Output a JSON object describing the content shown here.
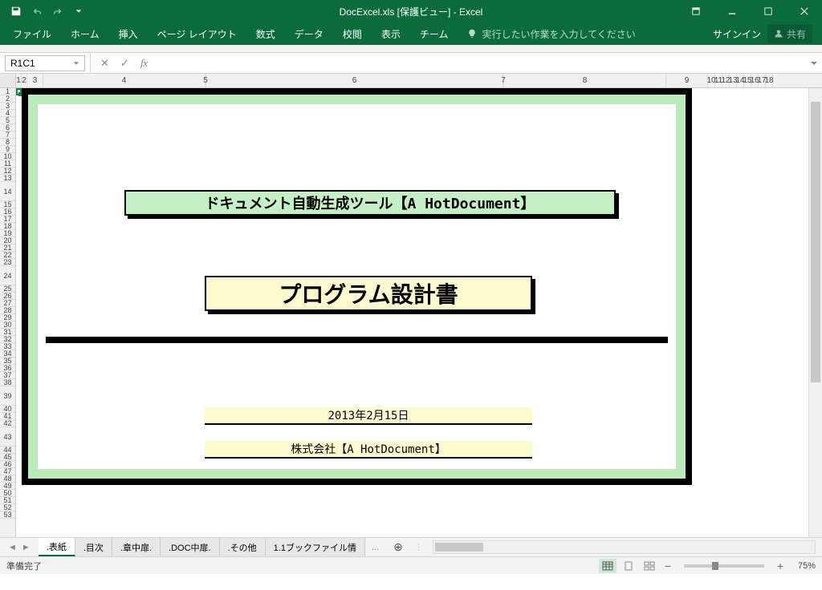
{
  "app": {
    "title": "DocExcel.xls [保護ビュー] - Excel",
    "signin": "サインイン",
    "share": "共有"
  },
  "ribbon": {
    "tabs": [
      "ファイル",
      "ホーム",
      "挿入",
      "ページ レイアウト",
      "数式",
      "データ",
      "校閲",
      "表示",
      "チーム"
    ],
    "tellme": "実行したい作業を入力してください"
  },
  "formula": {
    "namebox": "R1C1",
    "fx": "fx"
  },
  "columns": {
    "headers": [
      "1",
      "2",
      "3",
      "4",
      "5",
      "6",
      "7",
      "8",
      "9",
      "10",
      "11",
      "12",
      "13",
      "14",
      "15",
      "16",
      "17",
      "18"
    ],
    "widths": [
      7,
      7,
      20,
      202,
      1,
      370,
      1,
      202,
      52,
      9,
      9,
      9,
      9,
      9,
      9,
      9,
      9,
      9
    ]
  },
  "rows": [
    "1",
    "2",
    "3",
    "4",
    "5",
    "6",
    "7",
    "8",
    "9",
    "10",
    "11",
    "12",
    "13",
    "14",
    "15",
    "16",
    "17",
    "18",
    "19",
    "20",
    "21",
    "22",
    "23",
    "24",
    "25",
    "26",
    "27",
    "28",
    "29",
    "30",
    "31",
    "32",
    "33",
    "34",
    "35",
    "36",
    "37",
    "38",
    "39",
    "40",
    "41",
    "42",
    "43",
    "44",
    "45",
    "46",
    "47",
    "48",
    "49",
    "50",
    "51",
    "52",
    "53"
  ],
  "row_heights": {
    "default": 9,
    "14": 24,
    "24": 24,
    "39": 24,
    "43": 24
  },
  "cover": {
    "banner1": "ドキュメント自動生成ツール【A HotDocument】",
    "banner2": "プログラム設計書",
    "date": "2013年2月15日",
    "company": "株式会社【A HotDocument】"
  },
  "sheets": {
    "active": 0,
    "tabs": [
      ".表紙",
      ".目次",
      ".章中扉.",
      ".DOC中扉.",
      ".その他",
      "1.1ブックファイル情"
    ],
    "more": "..."
  },
  "status": {
    "ready": "準備完了",
    "zoom": "75%"
  }
}
